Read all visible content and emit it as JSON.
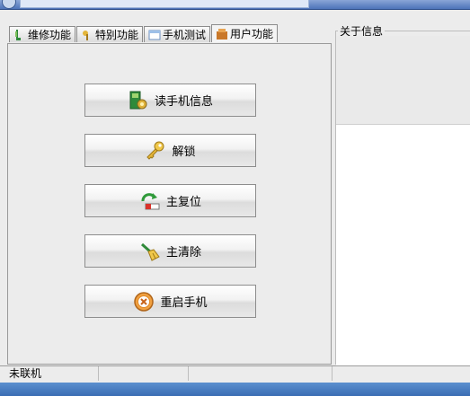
{
  "tabs": [
    {
      "label": "维修功能",
      "icon": "repair-icon",
      "active": false
    },
    {
      "label": "特别功能",
      "icon": "special-icon",
      "active": false
    },
    {
      "label": "手机测试",
      "icon": "phone-test-icon",
      "active": false
    },
    {
      "label": "用户功能",
      "icon": "user-icon",
      "active": true
    }
  ],
  "buttons": [
    {
      "label": "读手机信息",
      "icon": "read-info-icon"
    },
    {
      "label": "解锁",
      "icon": "key-icon"
    },
    {
      "label": "主复位",
      "icon": "reset-icon"
    },
    {
      "label": "主清除",
      "icon": "broom-icon"
    },
    {
      "label": "重启手机",
      "icon": "close-circle-icon"
    }
  ],
  "info": {
    "label": "关于信息"
  },
  "status": {
    "text": "未联机"
  }
}
